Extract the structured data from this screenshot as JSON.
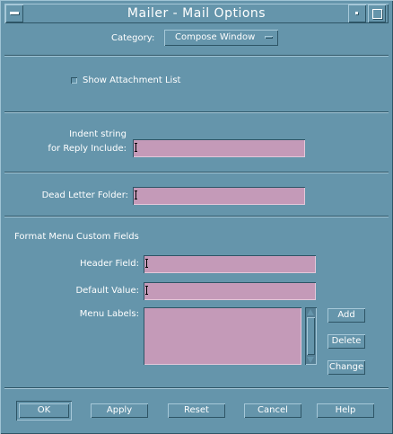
{
  "window": {
    "title": "Mailer - Mail Options"
  },
  "category": {
    "label": "Category:",
    "selected": "Compose Window"
  },
  "show_attachment_list": {
    "label": "Show Attachment List",
    "checked": false
  },
  "indent": {
    "label_line1": "Indent string",
    "label_line2": "for Reply Include:",
    "value": ""
  },
  "dead_letter": {
    "label": "Dead Letter Folder:",
    "value": ""
  },
  "custom_fields": {
    "heading": "Format Menu Custom Fields",
    "header_field_label": "Header Field:",
    "header_field_value": "",
    "default_value_label": "Default Value:",
    "default_value_value": "",
    "menu_labels_label": "Menu Labels:",
    "add": "Add",
    "delete": "Delete",
    "change": "Change"
  },
  "footer": {
    "ok": "OK",
    "apply": "Apply",
    "reset": "Reset",
    "cancel": "Cancel",
    "help": "Help"
  }
}
